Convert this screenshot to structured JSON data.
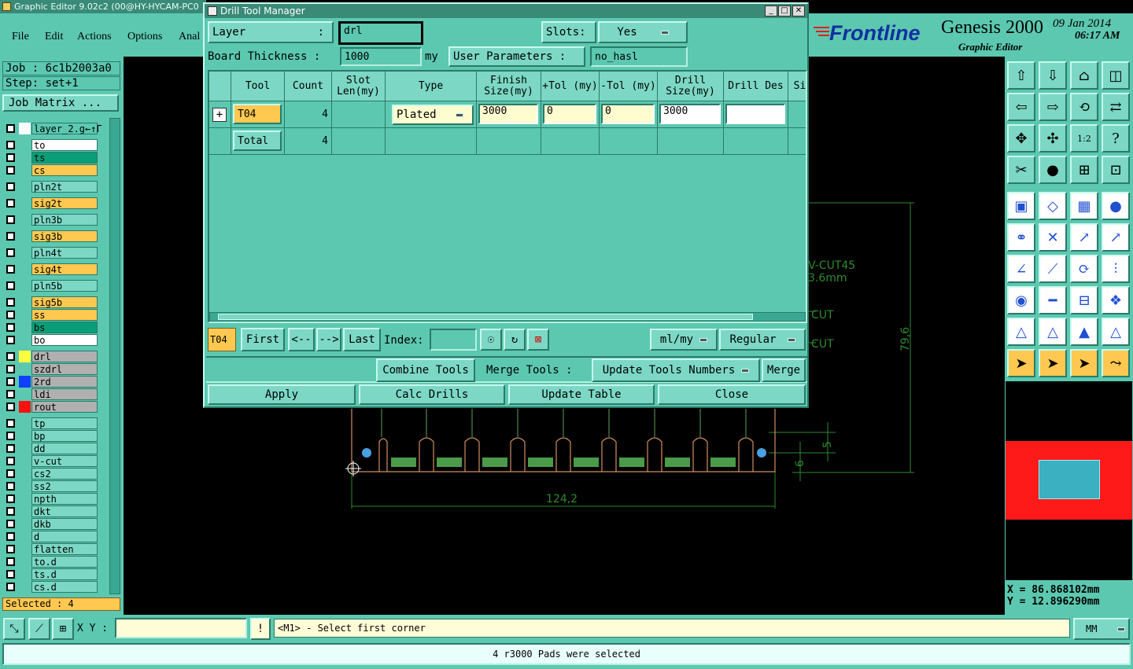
{
  "app": {
    "title": "Graphic Editor 9.02c2 (00@HY-HYCAM-PC0",
    "menus": [
      "File",
      "Edit",
      "Actions",
      "Options",
      "Anal"
    ],
    "brand": "Frontline",
    "product": "Genesis 2000",
    "subtitle": "Graphic Editor",
    "date": "09 Jan 2014",
    "time": "06:17 AM"
  },
  "left_panel": {
    "job": "Job : 6c1b2003a0",
    "step": "Step: set+1",
    "job_matrix": "Job Matrix ...",
    "layers": [
      {
        "name": "layer_2.g←↑Г",
        "color": "#5cc8b0",
        "sw": "#ffffff"
      },
      {
        "name": "to",
        "color": "#ffffff"
      },
      {
        "name": "ts",
        "color": "#0a9e78"
      },
      {
        "name": "cs",
        "color": "#ffc850"
      },
      {
        "name": "pln2t",
        "color": "#7cd8c4"
      },
      {
        "name": "sig2t",
        "color": "#ffc850"
      },
      {
        "name": "pln3b",
        "color": "#7cd8c4"
      },
      {
        "name": "sig3b",
        "color": "#ffc850"
      },
      {
        "name": "pln4t",
        "color": "#7cd8c4"
      },
      {
        "name": "sig4t",
        "color": "#ffc850"
      },
      {
        "name": "pln5b",
        "color": "#7cd8c4"
      },
      {
        "name": "sig5b",
        "color": "#ffc850"
      },
      {
        "name": "ss",
        "color": "#ffc850"
      },
      {
        "name": "bs",
        "color": "#0a9e78"
      },
      {
        "name": "bo",
        "color": "#ffffff"
      },
      {
        "name": "drl",
        "color": "#b0b0b0",
        "sw": "#ffff40"
      },
      {
        "name": "szdrl",
        "color": "#b0b0b0"
      },
      {
        "name": "2rd",
        "color": "#b0b0b0",
        "sw": "#1040ff"
      },
      {
        "name": "ldi",
        "color": "#b0b0b0"
      },
      {
        "name": "rout",
        "color": "#b0b0b0",
        "sw": "#ff1010"
      },
      {
        "name": "tp",
        "color": "#7cd8c4"
      },
      {
        "name": "bp",
        "color": "#7cd8c4"
      },
      {
        "name": "dd",
        "color": "#7cd8c4"
      },
      {
        "name": "v-cut",
        "color": "#7cd8c4"
      },
      {
        "name": "cs2",
        "color": "#7cd8c4"
      },
      {
        "name": "ss2",
        "color": "#7cd8c4"
      },
      {
        "name": "npth",
        "color": "#7cd8c4"
      },
      {
        "name": "dkt",
        "color": "#7cd8c4"
      },
      {
        "name": "dkb",
        "color": "#7cd8c4"
      },
      {
        "name": "d",
        "color": "#7cd8c4"
      },
      {
        "name": "flatten",
        "color": "#7cd8c4"
      },
      {
        "name": "to.d",
        "color": "#7cd8c4"
      },
      {
        "name": "ts.d",
        "color": "#7cd8c4"
      },
      {
        "name": "cs.d",
        "color": "#7cd8c4"
      }
    ],
    "selected": "Selected : 4"
  },
  "dialog": {
    "title": "Drill Tool Manager",
    "layer_label": "Layer",
    "layer_value": "drl",
    "slots_label": "Slots:",
    "slots_value": "Yes",
    "board_thickness_label": "Board Thickness :",
    "board_thickness_value": "1000",
    "board_thickness_unit": "my",
    "user_params_label": "User Parameters :",
    "user_params_value": "no_hasl",
    "columns": [
      "Tool",
      "Count",
      "Slot Len(my)",
      "Type",
      "Finish Size(my)",
      "+Tol (my)",
      "-Tol (my)",
      "Drill Size(my)",
      "Drill Des",
      "Si"
    ],
    "rows": [
      {
        "tool": "T04",
        "count": "4",
        "type": "Plated",
        "finish": "3000",
        "ptol": "0",
        "ntol": "0",
        "drill": "3000",
        "des": ""
      }
    ],
    "total": {
      "label": "Total",
      "count": "4"
    },
    "nav": {
      "current": "T04",
      "first": "First",
      "prev": "<--",
      "next": "-->",
      "last": "Last",
      "index_label": "Index:",
      "units": "ml/my",
      "mode": "Regular"
    },
    "actions": {
      "combine": "Combine Tools",
      "merge_label": "Merge Tools :",
      "update_numbers": "Update Tools Numbers",
      "merge": "Merge"
    },
    "footer": {
      "apply": "Apply",
      "calc": "Calc Drills",
      "update": "Update Table",
      "close": "Close"
    }
  },
  "canvas": {
    "labels": {
      "vcut": "V-CUT45",
      "vcut2": "3.6mm",
      "cut1": "CUT",
      "cut2": "CUT",
      "dim_h": "79,6",
      "dim_w": "124,2",
      "dim_5": "5",
      "dim_6": "6"
    }
  },
  "coords": {
    "x": "X = 86.868102mm",
    "y": "Y = 12.896290mm"
  },
  "bottom": {
    "xy_label": "X Y :",
    "prompt": "<M1> - Select first corner",
    "units": "MM",
    "status": "4 r3000 Pads were selected"
  }
}
